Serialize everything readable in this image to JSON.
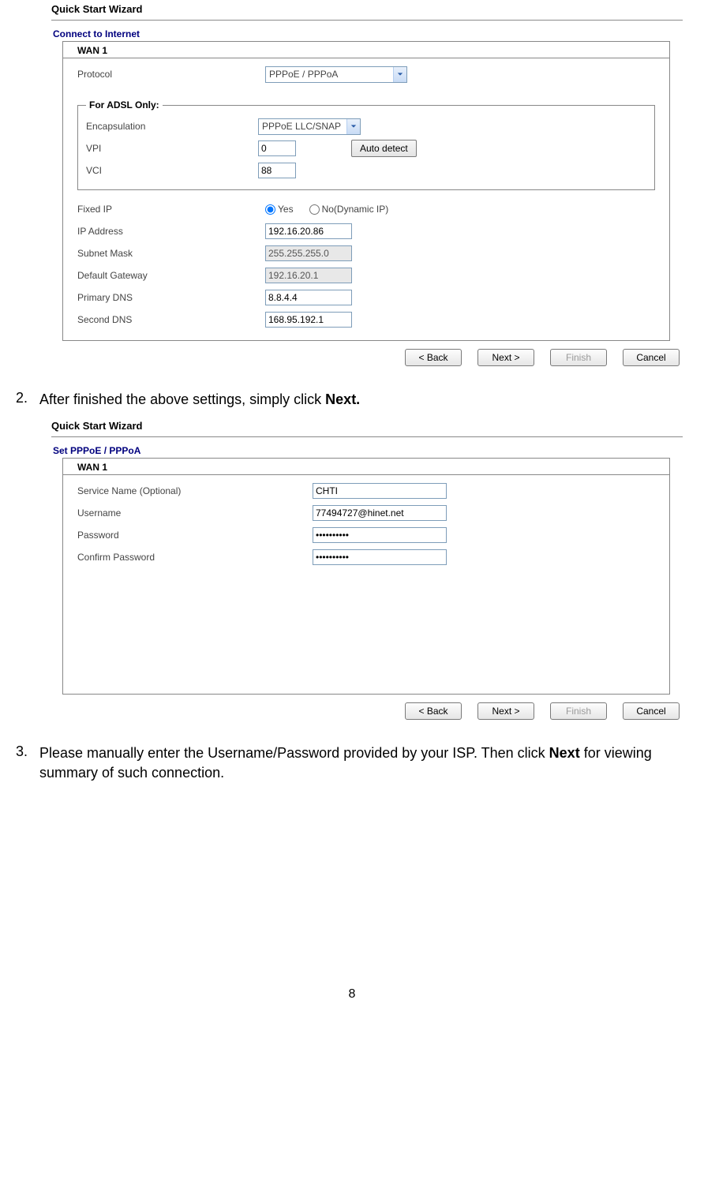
{
  "page_number": "8",
  "wizard1": {
    "title": "Quick Start Wizard",
    "section": "Connect to Internet",
    "panel_heading": "WAN 1",
    "protocol_label": "Protocol",
    "protocol_value": "PPPoE / PPPoA",
    "adsl_legend": "For ADSL Only:",
    "encap_label": "Encapsulation",
    "encap_value": "PPPoE LLC/SNAP",
    "vpi_label": "VPI",
    "vpi_value": "0",
    "autodetect_label": "Auto detect",
    "vci_label": "VCI",
    "vci_value": "88",
    "fixedip_label": "Fixed IP",
    "fixedip_yes": "Yes",
    "fixedip_no": "No(Dynamic IP)",
    "ip_label": "IP Address",
    "ip_value": "192.16.20.86",
    "mask_label": "Subnet Mask",
    "mask_value": "255.255.255.0",
    "gw_label": "Default Gateway",
    "gw_value": "192.16.20.1",
    "dns1_label": "Primary DNS",
    "dns1_value": "8.8.4.4",
    "dns2_label": "Second DNS",
    "dns2_value": "168.95.192.1",
    "btn_back": "< Back",
    "btn_next": "Next >",
    "btn_finish": "Finish",
    "btn_cancel": "Cancel"
  },
  "step2": {
    "num": "2.",
    "text_a": "After finished the above settings, simply click ",
    "text_b": "Next."
  },
  "wizard2": {
    "title": "Quick Start Wizard",
    "section": "Set PPPoE / PPPoA",
    "panel_heading": "WAN 1",
    "svc_label": "Service Name (Optional)",
    "svc_value": "CHTI",
    "user_label": "Username",
    "user_value": "77494727@hinet.net",
    "pwd_label": "Password",
    "pwd_value": "••••••••••",
    "cpwd_label": "Confirm Password",
    "cpwd_value": "••••••••••",
    "btn_back": "< Back",
    "btn_next": "Next >",
    "btn_finish": "Finish",
    "btn_cancel": "Cancel"
  },
  "step3": {
    "num": "3.",
    "text_a": "Please manually enter the Username/Password provided by your ISP. Then click ",
    "text_b": "Next",
    "text_c": " for viewing summary of such connection."
  }
}
